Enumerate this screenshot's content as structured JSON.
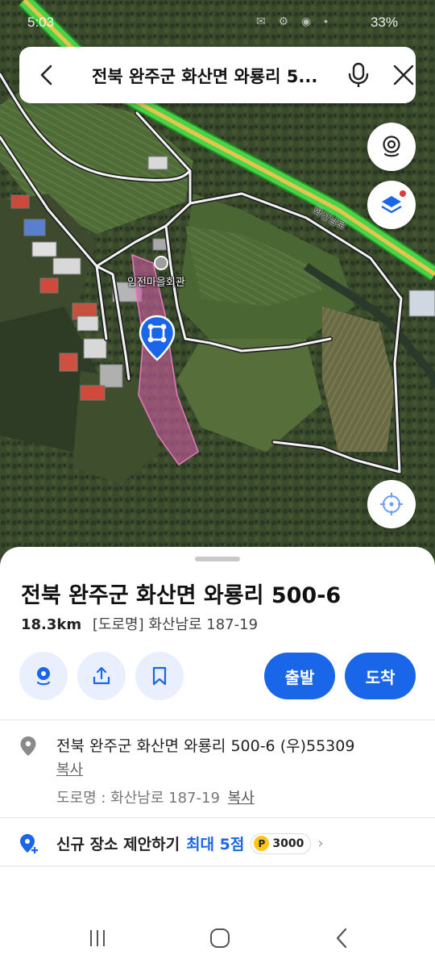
{
  "status_bar": {
    "time": "5:03",
    "battery": "33%"
  },
  "search": {
    "query": "전북 완주군 화산면 와룡리 5..."
  },
  "map": {
    "poi_label": "임전마을회관",
    "road_label": "화산남로"
  },
  "place": {
    "title": "전북 완주군 화산면 와룡리 500-6",
    "distance": "18.3km",
    "road_name": "[도로명] 화산남로 187-19",
    "depart_label": "출발",
    "arrive_label": "도착",
    "address": "전북 완주군 화산면 와룡리 500-6 (우)55309",
    "copy_label": "복사",
    "road_address": "도로명 : 화산남로 187-19",
    "copy_label_2": "복사"
  },
  "suggest": {
    "text": "신규 장소 제안하기",
    "max": "최대 5점",
    "point_icon": "P",
    "points": "3000"
  },
  "colors": {
    "accent": "#1a66e8",
    "parcel": "#c85a9e",
    "road_green": "#4bd24b",
    "road_yellow": "#e5c64a"
  },
  "icons": [
    "back-icon",
    "mic-icon",
    "close-icon",
    "camera-icon",
    "layers-icon",
    "location-pin-icon",
    "share-icon",
    "bookmark-icon",
    "target-icon",
    "place-pin-icon",
    "add-place-icon"
  ]
}
